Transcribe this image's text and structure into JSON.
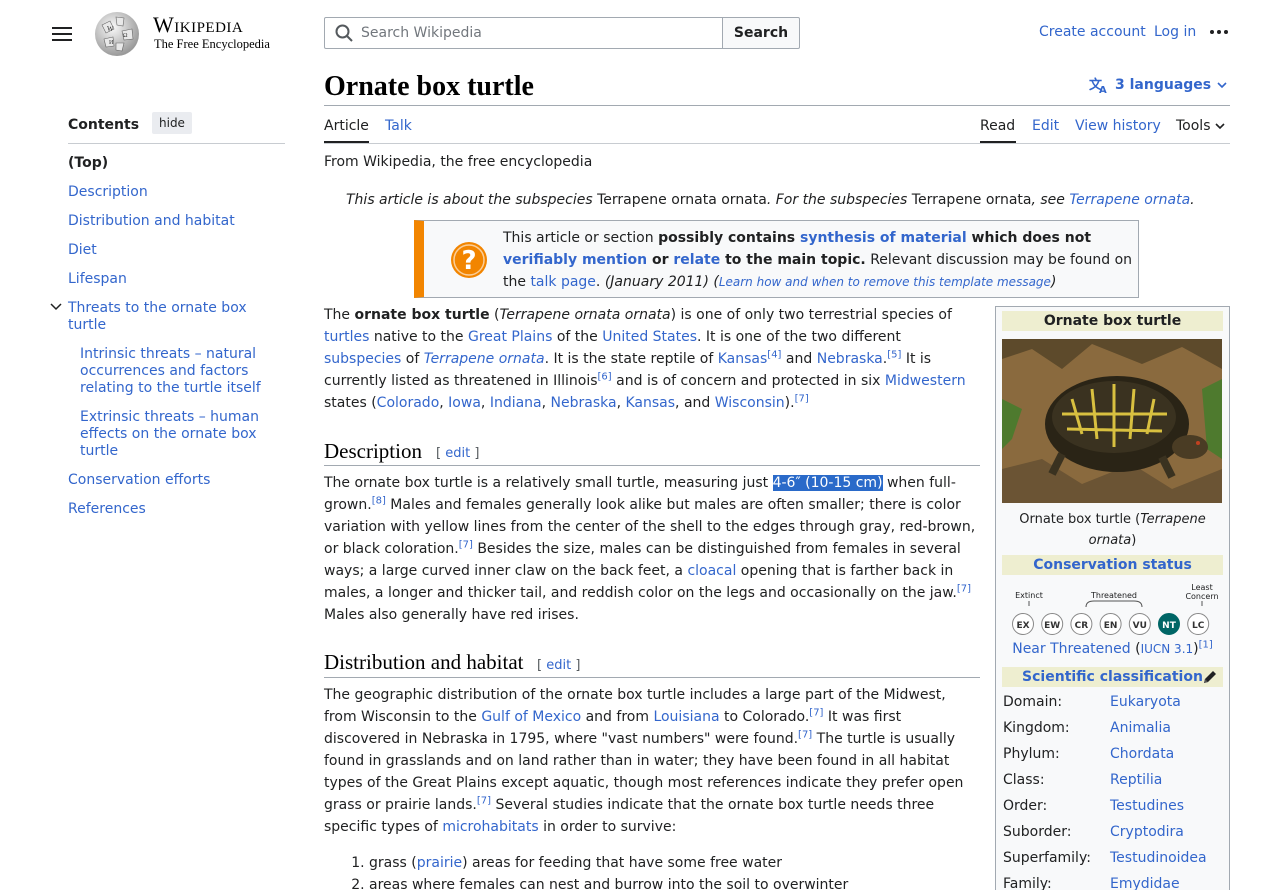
{
  "header": {
    "wordmark": "Wikipedia",
    "tagline": "The Free Encyclopedia",
    "search_placeholder": "Search Wikipedia",
    "search_button": "Search",
    "create_account": "Create account",
    "log_in": "Log in"
  },
  "toc": {
    "title": "Contents",
    "hide": "hide",
    "items": [
      {
        "label": "(Top)"
      },
      {
        "label": "Description"
      },
      {
        "label": "Distribution and habitat"
      },
      {
        "label": "Diet"
      },
      {
        "label": "Lifespan"
      },
      {
        "label": "Threats to the ornate box turtle"
      },
      {
        "label": "Intrinsic threats – natural occurrences and factors relating to the turtle itself"
      },
      {
        "label": "Extrinsic threats – human effects on the ornate box turtle"
      },
      {
        "label": "Conservation efforts"
      },
      {
        "label": "References"
      }
    ]
  },
  "page": {
    "title": "Ornate box turtle",
    "languages": "3 languages",
    "tabs": {
      "article": "Article",
      "talk": "Talk",
      "read": "Read",
      "edit": "Edit",
      "history": "View history",
      "tools": "Tools"
    },
    "from": "From Wikipedia, the free encyclopedia",
    "hatnote": {
      "a": "This article is about the subspecies ",
      "b": "Terrapene ornata ornata",
      "c": ". For the subspecies ",
      "d": "Terrapene ornata",
      "e": ", see ",
      "f": "Terrapene ornata",
      "g": "."
    }
  },
  "ambox": {
    "t1": "This article or section ",
    "t2": "possibly contains ",
    "t3": "synthesis of material",
    "t4": " which does not ",
    "t5": "verifiably mention",
    "t6": " or ",
    "t7": "relate",
    "t8": " to the main topic.",
    "t9": " Relevant discussion may be found on the ",
    "t10": "talk page",
    "t11": ". ",
    "t12": "(January 2011)",
    "t13": " (",
    "t14": "Learn how and when to remove this template message",
    "t15": ")"
  },
  "intro": {
    "s1": "The ",
    "s2": "ornate box turtle",
    "s3": " (",
    "s4": "Terrapene ornata ornata",
    "s5": ") is one of only two terrestrial species of ",
    "s6": "turtles",
    "s7": " native to the ",
    "s8": "Great Plains",
    "s9": " of the ",
    "s10": "United States",
    "s11": ". It is one of the two different ",
    "s12": "subspecies",
    "s13": " of ",
    "s14": "Terrapene ornata",
    "s15": ". It is the state reptile of ",
    "s16": "Kansas",
    "s17": "[4]",
    "s18": " and ",
    "s19": "Nebraska",
    "s20": ".",
    "s21": "[5]",
    "s22": " It is currently listed as threatened in Illinois",
    "s23": "[6]",
    "s24": " and is of concern and protected in six ",
    "s25": "Midwestern",
    "s26": " states (",
    "s27": "Colorado",
    "s28": ", ",
    "s29": "Iowa",
    "s30": ", ",
    "s31": "Indiana",
    "s32": ", ",
    "s33": "Nebraska",
    "s34": ", ",
    "s35": "Kansas",
    "s36": ", and ",
    "s37": "Wisconsin",
    "s38": ").",
    "s39": "[7]"
  },
  "description": {
    "heading": "Description",
    "edit": "edit",
    "s1": "The ornate box turtle is a relatively small turtle, measuring just ",
    "s2": "4-6″ (10-15 cm)",
    "s3": " when full-grown.",
    "s4": "[8]",
    "s5": " Males and females generally look alike but males are often smaller; there is color variation with yellow lines from the center of the shell to the edges through gray, red-brown, or black coloration.",
    "s6": "[7]",
    "s7": " Besides the size, males can be distinguished from females in several ways; a large curved inner claw on the back feet, a ",
    "s8": "cloacal",
    "s9": " opening that is farther back in males, a longer and thicker tail, and reddish color on the legs and occasionally on the jaw.",
    "s10": "[7]",
    "s11": " Males also generally have red irises."
  },
  "distribution": {
    "heading": "Distribution and habitat",
    "edit": "edit",
    "s1": "The geographic distribution of the ornate box turtle includes a large part of the Midwest, from Wisconsin to the ",
    "s2": "Gulf of Mexico",
    "s3": " and from ",
    "s4": "Louisiana",
    "s5": " to Colorado.",
    "s6": "[7]",
    "s7": " It was first discovered in Nebraska in 1795, where \"vast numbers\" were found.",
    "s8": "[7]",
    "s9": " The turtle is usually found in grasslands and on land rather than in water; they have been found in all habitat types of the Great Plains except aquatic, though most references indicate they prefer open grass or prairie lands.",
    "s10": "[7]",
    "s11": " Several studies indicate that the ornate box turtle needs three specific types of ",
    "s12": "microhabitats",
    "s13": " in order to survive:",
    "list1a": "grass (",
    "list1b": "prairie",
    "list1c": ") areas for feeding that have some free water",
    "list2": "areas where females can nest and burrow into the soil to overwinter"
  },
  "infobox": {
    "title": "Ornate box turtle",
    "caption_a": "Ornate box turtle (",
    "caption_b": "Terrapene ornata",
    "caption_c": ")",
    "conservation_heading": "Conservation status",
    "iucn": {
      "extinct": "Extinct",
      "threatened": "Threatened",
      "least_concern_1": "Least",
      "least_concern_2": "Concern",
      "codes": [
        "EX",
        "EW",
        "CR",
        "EN",
        "VU",
        "NT",
        "LC"
      ],
      "selected": "NT",
      "selected_color": "#006666"
    },
    "status_a": "Near Threatened",
    "status_b": " (",
    "status_c": "IUCN 3.1",
    "status_d": ")",
    "status_e": "[1]",
    "sci_heading": "Scientific classification",
    "taxonomy": [
      {
        "rank": "Domain:",
        "value": "Eukaryota"
      },
      {
        "rank": "Kingdom:",
        "value": "Animalia"
      },
      {
        "rank": "Phylum:",
        "value": "Chordata"
      },
      {
        "rank": "Class:",
        "value": "Reptilia"
      },
      {
        "rank": "Order:",
        "value": "Testudines"
      },
      {
        "rank": "Suborder:",
        "value": "Cryptodira"
      },
      {
        "rank": "Superfamily:",
        "value": "Testudinoidea"
      },
      {
        "rank": "Family:",
        "value": "Emydidae"
      }
    ]
  },
  "colors": {
    "link": "#3366cc",
    "ambox_accent": "#f28500",
    "infobox_header": "#eeeed0",
    "highlight": "#2a6ac9"
  }
}
